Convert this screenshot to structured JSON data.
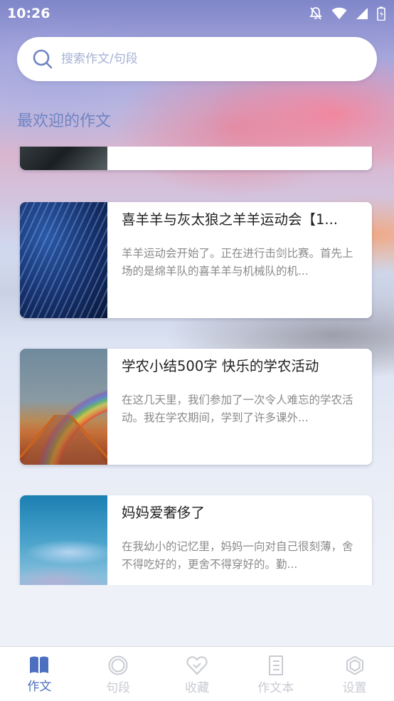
{
  "status_bar": {
    "time": "10:26",
    "icons": [
      "notifications-off-icon",
      "wifi-icon",
      "signal-icon",
      "battery-icon"
    ]
  },
  "search": {
    "placeholder": "搜索作文/句段"
  },
  "section": {
    "title": "最欢迎的作文"
  },
  "articles": [
    {
      "title": "喜羊羊与灰太狼之羊羊运动会【1...",
      "excerpt": "羊羊运动会开始了。正在进行击剑比赛。首先上场的是绵羊队的喜羊羊与机械队的机...",
      "thumbnail": "starry-water-image"
    },
    {
      "title": "学农小结500字 快乐的学农活动",
      "excerpt": "在这几天里，我们参加了一次令人难忘的学农活动。我在学农期间，学到了许多课外...",
      "thumbnail": "rainbow-boardwalk-image"
    },
    {
      "title": "妈妈爱奢侈了",
      "excerpt": "在我幼小的记忆里，妈妈一向对自己很刻薄，舍不得吃好的，更舍不得穿好的。勤...",
      "thumbnail": "blue-sky-image"
    }
  ],
  "tabs": [
    {
      "label": "作文",
      "icon": "book-icon",
      "active": true
    },
    {
      "label": "句段",
      "icon": "circle-icon",
      "active": false
    },
    {
      "label": "收藏",
      "icon": "heart-icon",
      "active": false
    },
    {
      "label": "作文本",
      "icon": "notebook-icon",
      "active": false
    },
    {
      "label": "设置",
      "icon": "hexagon-icon",
      "active": false
    }
  ],
  "colors": {
    "accent": "#4c6fbf",
    "section_title": "#6f84c2",
    "tab_inactive": "#c9cbd3",
    "placeholder": "#a7b2d4"
  }
}
